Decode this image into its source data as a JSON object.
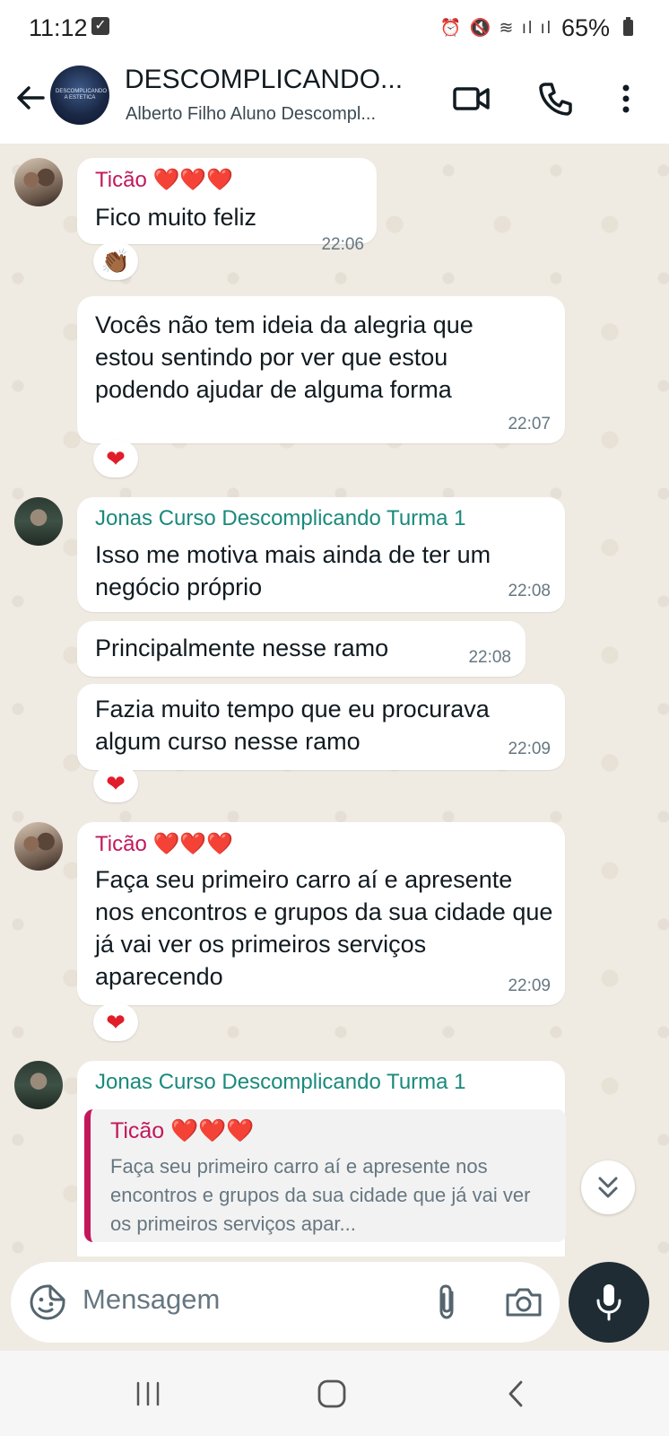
{
  "status_bar": {
    "time": "11:12",
    "battery": "65%"
  },
  "header": {
    "group_name": "DESCOMPLICANDO...",
    "members_preview": "Alberto Filho Aluno Descompl...",
    "avatar_logo_text": "DESCOMPLICANDO A ESTETICA"
  },
  "messages": [
    {
      "sender": "Ticão ❤️❤️❤️",
      "text": "Fico muito feliz",
      "time": "22:06",
      "reaction": "👏🏾"
    },
    {
      "sender": "",
      "text": "Vocês não tem ideia da alegria que estou sentindo por ver que estou podendo ajudar de alguma forma",
      "time": "22:07",
      "reaction": "❤"
    },
    {
      "sender": "Jonas Curso Descomplicando Turma 1",
      "text": "Isso me motiva mais ainda de ter um negócio próprio",
      "time": "22:08"
    },
    {
      "sender": "",
      "text": "Principalmente nesse ramo",
      "time": "22:08"
    },
    {
      "sender": "",
      "text": "Fazia muito tempo que eu procurava algum curso nesse ramo",
      "time": "22:09",
      "reaction": "❤"
    },
    {
      "sender": "Ticão ❤️❤️❤️",
      "text": "Faça seu primeiro carro aí e apresente nos encontros e grupos da sua cidade que já vai ver os primeiros serviços aparecendo",
      "time": "22:09",
      "reaction": "❤"
    },
    {
      "sender": "Jonas Curso Descomplicando Turma 1",
      "quote_sender": "Ticão ❤️❤️❤️",
      "quote_text": "Faça seu primeiro carro aí e apresente nos encontros e grupos da sua cidade que já vai ver os primeiros serviços apar..."
    }
  ],
  "composer": {
    "placeholder": "Mensagem"
  },
  "colors": {
    "chat_bg": "#efeae2",
    "ticao_name": "#c2185b",
    "jonas_name": "#1a8a7c",
    "mic_button": "#1f2c34"
  },
  "icons": [
    "back-arrow-icon",
    "video-call-icon",
    "phone-icon",
    "more-vert-icon",
    "emoji-sticker-icon",
    "paperclip-icon",
    "camera-icon",
    "mic-icon",
    "double-chevron-down-icon",
    "recents-icon",
    "home-icon",
    "back-nav-icon"
  ]
}
